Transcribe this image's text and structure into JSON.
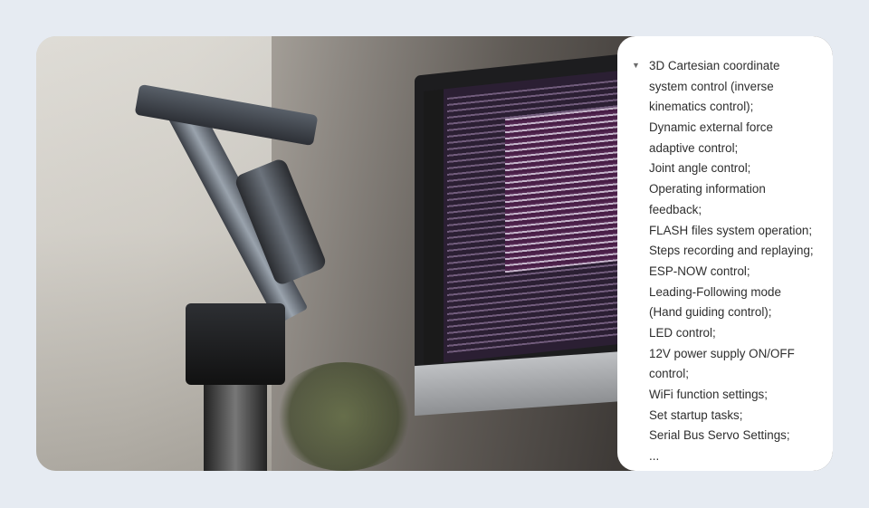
{
  "photo": {
    "description_alt": ""
  },
  "features": {
    "bullet_icon": "triangle-down",
    "lines": [
      "3D Cartesian coordinate",
      "system control (inverse",
      "kinematics control);",
      "Dynamic external force",
      "adaptive control;",
      "Joint angle control;",
      "Operating information",
      "feedback;",
      "FLASH files system operation;",
      "Steps recording and replaying;",
      "ESP-NOW control;",
      "Leading-Following mode",
      "(Hand guiding control);",
      "LED control;",
      "12V power supply ON/OFF",
      "control;",
      "WiFi function settings;",
      "Set startup tasks;",
      "Serial Bus Servo Settings;",
      "..."
    ]
  }
}
